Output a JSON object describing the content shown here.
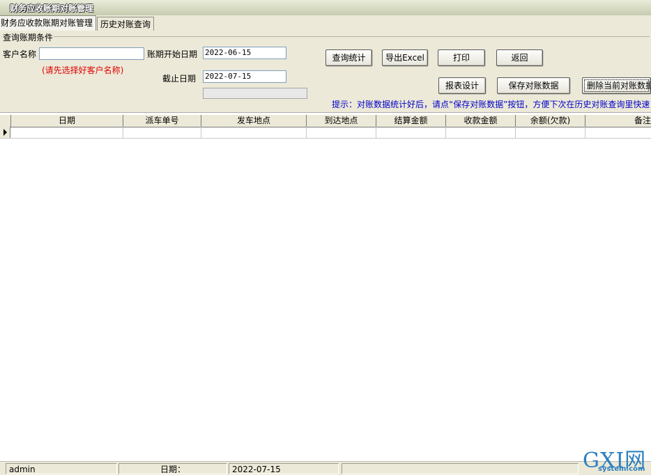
{
  "window": {
    "title": "财务应收账期对账管理"
  },
  "tabs": [
    {
      "label": "财务应收款账期对账管理"
    },
    {
      "label": "历史对账查询"
    }
  ],
  "query": {
    "group_label": "查询账期条件",
    "customer_label": "客户名称",
    "customer_value": "",
    "customer_hint": "(请先选择好客户名称)",
    "start_label": "账期开始日期",
    "start_value": "2022-06-15",
    "end_label": "截止日期",
    "end_value": "2022-07-15"
  },
  "buttons": {
    "query": "查询统计",
    "export": "导出Excel",
    "print": "打印",
    "back": "返回",
    "report_design": "报表设计",
    "save": "保存对账数据",
    "delete": "删除当前对账数据"
  },
  "tip": "提示：对账数据统计好后，请点“保存对账数据”按钮，方便下次在历史对账查询里快速",
  "grid": {
    "columns": [
      "日期",
      "派车单号",
      "发车地点",
      "到达地点",
      "结算金额",
      "收款金额",
      "余额(欠款)",
      "备注"
    ],
    "rows": [
      [
        "",
        "",
        "",
        "",
        "",
        "",
        "",
        ""
      ]
    ]
  },
  "status": {
    "user": "admin",
    "date_label": "日期：",
    "date_value": "2022-07-15"
  },
  "watermark": {
    "text": "GXI网",
    "sub": "system.com"
  }
}
